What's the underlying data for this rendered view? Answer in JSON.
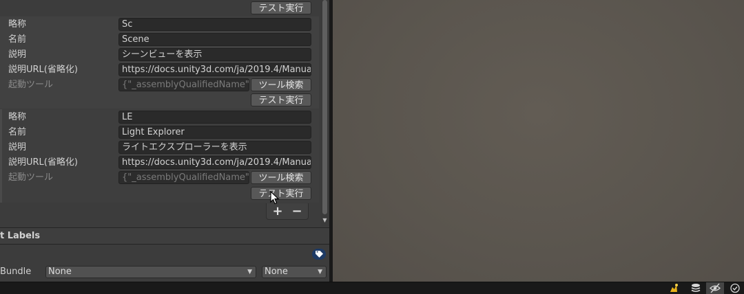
{
  "top_button": "テスト実行",
  "entries": [
    {
      "short_label": "略称",
      "short_value": "Sc",
      "name_label": "名前",
      "name_value": "Scene",
      "desc_label": "説明",
      "desc_value": "シーンビューを表示",
      "url_label": "説明URL(省略化)",
      "url_value": "https://docs.unity3d.com/ja/2019.4/Manual/",
      "tool_label": "起動ツール",
      "tool_value": "{\"_assemblyQualifiedName\":\"l",
      "search_button": "ツール検索",
      "test_button": "テスト実行"
    },
    {
      "short_label": "略称",
      "short_value": "LE",
      "name_label": "名前",
      "name_value": "Light Explorer",
      "desc_label": "説明",
      "desc_value": "ライトエクスプローラーを表示",
      "url_label": "説明URL(省略化)",
      "url_value": "https://docs.unity3d.com/ja/2019.4/Manual/",
      "tool_label": "起動ツール",
      "tool_value": "{\"_assemblyQualifiedName\":\"l",
      "search_button": "ツール検索",
      "test_button": "テスト実行"
    }
  ],
  "list_footer": {
    "add": "+",
    "remove": "−"
  },
  "asset_labels": {
    "title": "t Labels",
    "bundle_label": "Bundle",
    "bundle_value": "None",
    "variant_value": "None"
  },
  "colors": {
    "accent_tag": "#1e3b66",
    "scene_bg": "#5a5650",
    "panel_bg": "#3c3c3c"
  },
  "icons": [
    "tag-icon",
    "collab-icon",
    "layers-icon",
    "visibility-icon",
    "check-circle-icon",
    "mouse-cursor-icon"
  ]
}
